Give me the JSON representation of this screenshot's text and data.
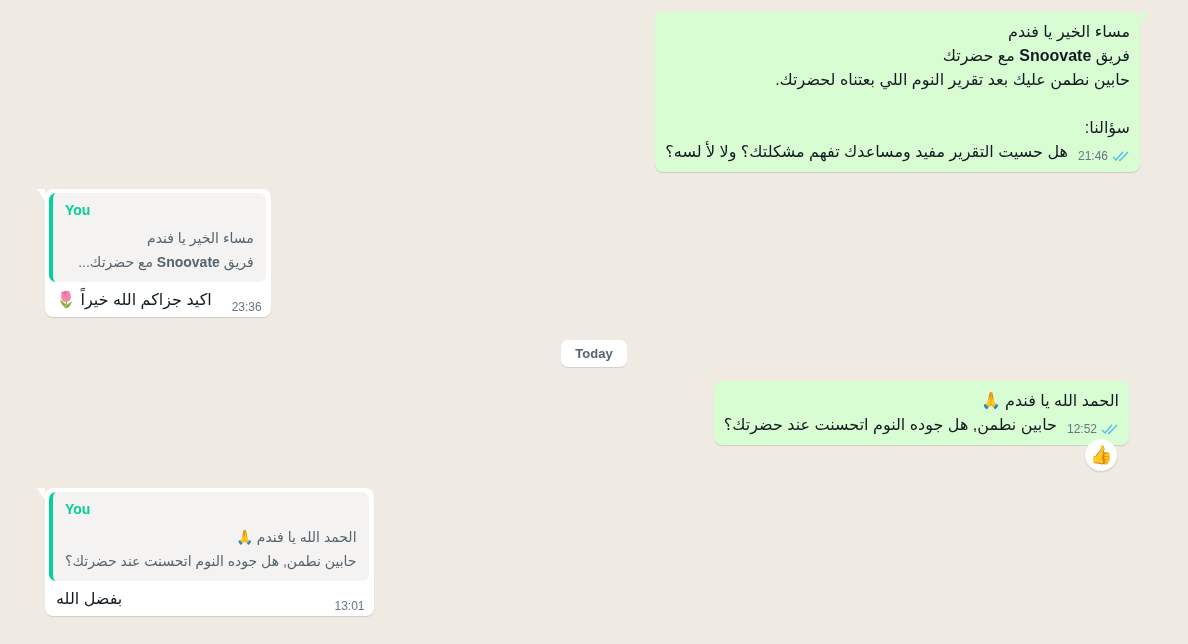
{
  "messages": [
    {
      "kind": "outgoing",
      "tail": true,
      "paragraphs": [
        [
          "مساء الخير يا فندم",
          "فريق **Snoovate** مع حضرتك",
          "حابين نطمن عليك بعد تقرير النوم اللي بعتناه لحضرتك."
        ],
        [
          "سؤالنا:",
          "هل حسيت التقرير مفيد ومساعدك تفهم مشكلتك؟ ولا لأ لسه؟"
        ]
      ],
      "time": "21:46",
      "read": true
    },
    {
      "kind": "incoming",
      "tail": true,
      "quote": {
        "author": "You",
        "lines": [
          "مساء الخير يا فندم",
          "فريق **Snoovate** مع حضرتك..."
        ]
      },
      "text": "اكيد جزاكم الله خيراً 🌷",
      "time": "23:36"
    },
    {
      "kind": "date",
      "label": "Today"
    },
    {
      "kind": "outgoing",
      "tail": false,
      "paragraphs": [
        [
          "الحمد الله يا فندم 🙏",
          "حابين نطمن, هل جوده النوم اتحسنت عند حضرتك؟"
        ]
      ],
      "time": "12:52",
      "read": true,
      "reaction": "👍"
    },
    {
      "kind": "incoming",
      "tail": true,
      "quote": {
        "author": "You",
        "lines": [
          "الحمد الله يا فندم 🙏",
          "حابين نطمن, هل جوده النوم اتحسنت عند حضرتك؟"
        ]
      },
      "text": "بفضل الله",
      "time": "13:01"
    }
  ]
}
